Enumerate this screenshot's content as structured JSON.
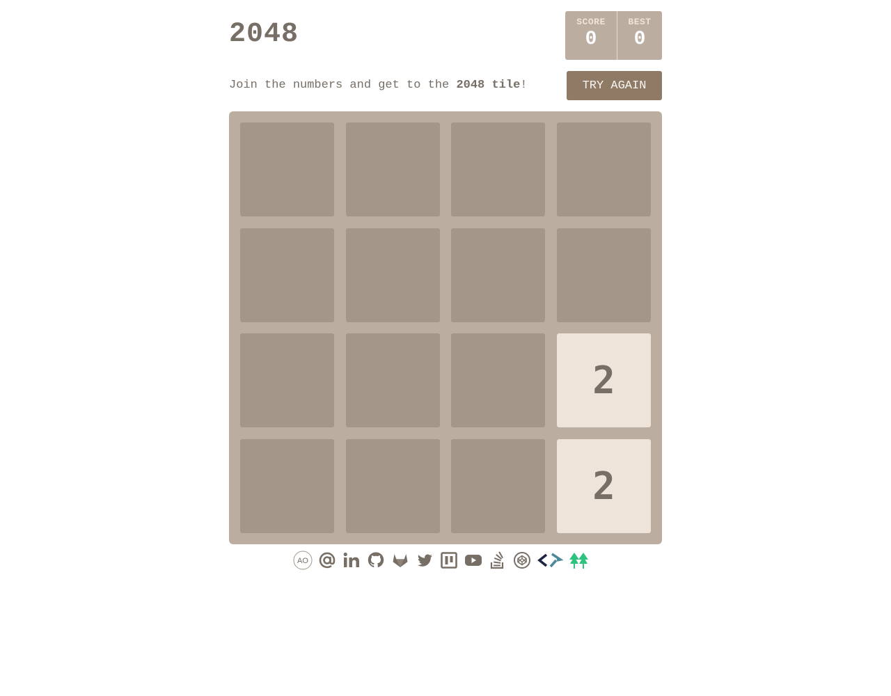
{
  "header": {
    "title": "2048",
    "score_label": "SCORE",
    "score_value": "0",
    "best_label": "BEST",
    "best_value": "0"
  },
  "intro": {
    "prefix": "Join the numbers and get to the ",
    "highlight": "2048 tile",
    "suffix": "!"
  },
  "try_again_label": "TRY AGAIN",
  "board": {
    "rows": [
      [
        "",
        "",
        "",
        ""
      ],
      [
        "",
        "",
        "",
        ""
      ],
      [
        "",
        "",
        "",
        "2"
      ],
      [
        "",
        "",
        "",
        "2"
      ]
    ]
  },
  "social_links": [
    {
      "name": "ao-logo-icon",
      "label": "AO"
    },
    {
      "name": "email-at-icon"
    },
    {
      "name": "linkedin-icon"
    },
    {
      "name": "github-icon"
    },
    {
      "name": "gitlab-icon"
    },
    {
      "name": "twitter-icon"
    },
    {
      "name": "medium-icon"
    },
    {
      "name": "youtube-icon"
    },
    {
      "name": "stackoverflow-icon"
    },
    {
      "name": "codepen-icon"
    },
    {
      "name": "code-arrows-icon"
    },
    {
      "name": "tree-icon"
    }
  ],
  "colors": {
    "board": "#bbada0",
    "cell": "#a39789",
    "tile_2": "#eee4da",
    "text": "#776e65",
    "button": "#8f7a66",
    "teal": "#4a8a9a",
    "navy": "#1d2340",
    "green": "#2ec27e"
  }
}
